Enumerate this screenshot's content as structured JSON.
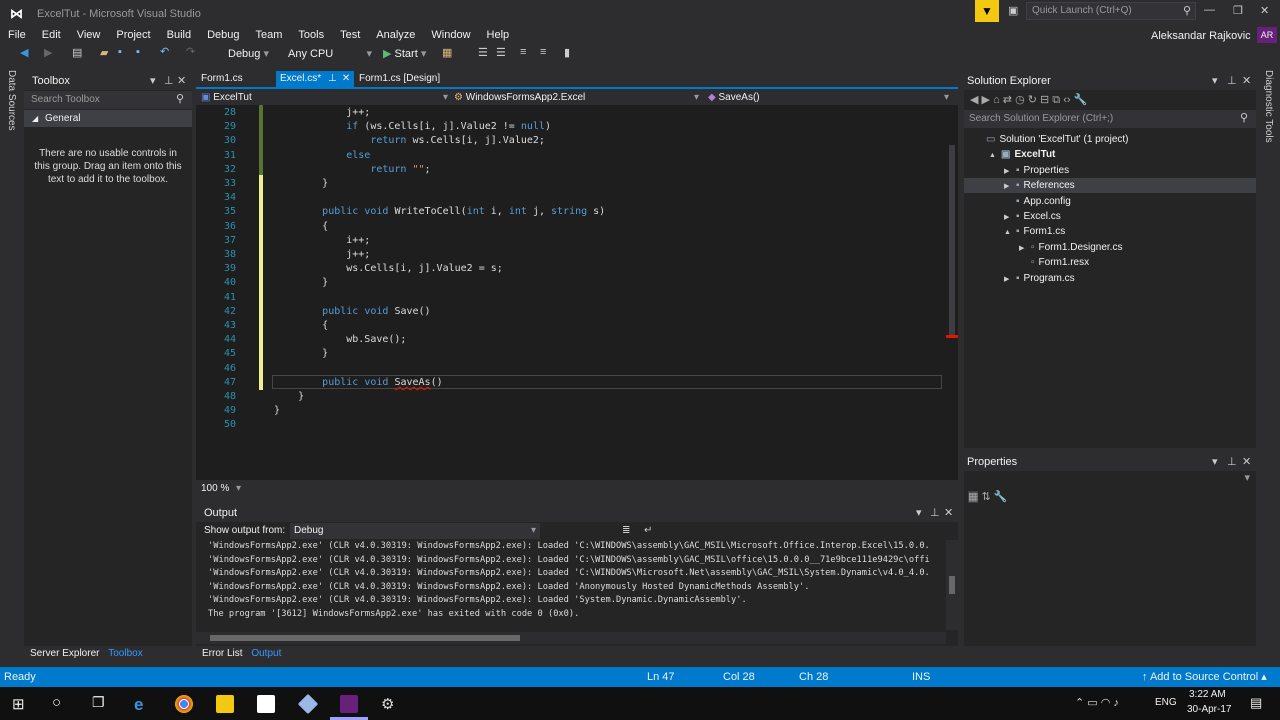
{
  "window": {
    "title": "ExcelTut - Microsoft Visual Studio",
    "quick_launch_placeholder": "Quick Launch (Ctrl+Q)",
    "user": "Aleksandar Rajkovic",
    "user_initials": "AR"
  },
  "menu": [
    "File",
    "Edit",
    "View",
    "Project",
    "Build",
    "Debug",
    "Team",
    "Tools",
    "Test",
    "Analyze",
    "Window",
    "Help"
  ],
  "toolbar": {
    "config": "Debug",
    "platform": "Any CPU",
    "start": "Start"
  },
  "left_strip": {
    "data_sources": "Data Sources"
  },
  "toolbox": {
    "title": "Toolbox",
    "search_placeholder": "Search Toolbox",
    "group": "General",
    "empty_text": "There are no usable controls in this group. Drag an item onto this text to add it to the toolbox."
  },
  "tabs": [
    {
      "label": "Form1.cs",
      "active": false
    },
    {
      "label": "Excel.cs*",
      "active": true
    },
    {
      "label": "Form1.cs [Design]",
      "active": false
    }
  ],
  "nav": {
    "project": "ExcelTut",
    "class": "WindowsFormsApp2.Excel",
    "member": "SaveAs()"
  },
  "code": [
    {
      "n": "28",
      "seg": [
        [
          "            ",
          "tx"
        ],
        [
          "j++;",
          "tx"
        ]
      ]
    },
    {
      "n": "29",
      "seg": [
        [
          "            ",
          "tx"
        ],
        [
          "if",
          "kw"
        ],
        [
          " (ws.Cells[i, j].Value2 != ",
          "tx"
        ],
        [
          "null",
          "kw"
        ],
        [
          ")",
          "tx"
        ]
      ]
    },
    {
      "n": "30",
      "seg": [
        [
          "                ",
          "tx"
        ],
        [
          "return",
          "kw"
        ],
        [
          " ws.Cells[i, j].Value2;",
          "tx"
        ]
      ]
    },
    {
      "n": "31",
      "seg": [
        [
          "            ",
          "tx"
        ],
        [
          "else",
          "kw"
        ]
      ]
    },
    {
      "n": "32",
      "seg": [
        [
          "                ",
          "tx"
        ],
        [
          "return",
          "kw"
        ],
        [
          " ",
          "tx"
        ],
        [
          "\"\"",
          "str"
        ],
        [
          ";",
          "tx"
        ]
      ]
    },
    {
      "n": "33",
      "seg": [
        [
          "        }",
          "tx"
        ]
      ]
    },
    {
      "n": "34",
      "seg": []
    },
    {
      "n": "35",
      "seg": [
        [
          "        ",
          "tx"
        ],
        [
          "public",
          "kw"
        ],
        [
          " ",
          "tx"
        ],
        [
          "void",
          "kw"
        ],
        [
          " WriteToCell(",
          "tx"
        ],
        [
          "int",
          "kw"
        ],
        [
          " i, ",
          "tx"
        ],
        [
          "int",
          "kw"
        ],
        [
          " j, ",
          "tx"
        ],
        [
          "string",
          "kw"
        ],
        [
          " s)",
          "tx"
        ]
      ]
    },
    {
      "n": "36",
      "seg": [
        [
          "        {",
          "tx"
        ]
      ]
    },
    {
      "n": "37",
      "seg": [
        [
          "            i++;",
          "tx"
        ]
      ]
    },
    {
      "n": "38",
      "seg": [
        [
          "            j++;",
          "tx"
        ]
      ]
    },
    {
      "n": "39",
      "seg": [
        [
          "            ws.Cells[i, j].Value2 = s;",
          "tx"
        ]
      ]
    },
    {
      "n": "40",
      "seg": [
        [
          "        }",
          "tx"
        ]
      ]
    },
    {
      "n": "41",
      "seg": []
    },
    {
      "n": "42",
      "seg": [
        [
          "        ",
          "tx"
        ],
        [
          "public",
          "kw"
        ],
        [
          " ",
          "tx"
        ],
        [
          "void",
          "kw"
        ],
        [
          " Save()",
          "tx"
        ]
      ]
    },
    {
      "n": "43",
      "seg": [
        [
          "        {",
          "tx"
        ]
      ]
    },
    {
      "n": "44",
      "seg": [
        [
          "            wb.Save();",
          "tx"
        ]
      ]
    },
    {
      "n": "45",
      "seg": [
        [
          "        }",
          "tx"
        ]
      ]
    },
    {
      "n": "46",
      "seg": []
    },
    {
      "n": "47",
      "seg": [
        [
          "        ",
          "tx"
        ],
        [
          "public",
          "kw"
        ],
        [
          " ",
          "tx"
        ],
        [
          "void",
          "kw"
        ],
        [
          " ",
          "tx"
        ],
        [
          "SaveAs",
          "err"
        ],
        [
          "()",
          "tx"
        ]
      ]
    },
    {
      "n": "48",
      "seg": [
        [
          "    }",
          "tx"
        ]
      ]
    },
    {
      "n": "49",
      "seg": [
        [
          "}",
          "tx"
        ]
      ]
    },
    {
      "n": "50",
      "seg": []
    }
  ],
  "editor": {
    "zoom": "100 %"
  },
  "output": {
    "title": "Output",
    "show_from_label": "Show output from:",
    "source": "Debug",
    "lines": [
      "'WindowsFormsApp2.exe' (CLR v4.0.30319: WindowsFormsApp2.exe): Loaded 'C:\\WINDOWS\\assembly\\GAC_MSIL\\Microsoft.Office.Interop.Excel\\15.0.0.",
      "'WindowsFormsApp2.exe' (CLR v4.0.30319: WindowsFormsApp2.exe): Loaded 'C:\\WINDOWS\\assembly\\GAC_MSIL\\office\\15.0.0.0__71e9bce111e9429c\\offi",
      "'WindowsFormsApp2.exe' (CLR v4.0.30319: WindowsFormsApp2.exe): Loaded 'C:\\WINDOWS\\Microsoft.Net\\assembly\\GAC_MSIL\\System.Dynamic\\v4.0_4.0.",
      "'WindowsFormsApp2.exe' (CLR v4.0.30319: WindowsFormsApp2.exe): Loaded 'Anonymously Hosted DynamicMethods Assembly'.",
      "'WindowsFormsApp2.exe' (CLR v4.0.30319: WindowsFormsApp2.exe): Loaded 'System.Dynamic.DynamicAssembly'.",
      "The program '[3612] WindowsFormsApp2.exe' has exited with code 0 (0x0)."
    ]
  },
  "bottom_tabs": {
    "left": [
      "Server Explorer",
      "Toolbox"
    ],
    "center": [
      "Error List",
      "Output"
    ]
  },
  "solution": {
    "title": "Solution Explorer",
    "search_placeholder": "Search Solution Explorer (Ctrl+;)",
    "items": [
      {
        "label": "Solution 'ExcelTut' (1 project)",
        "level": 0,
        "arrow": ""
      },
      {
        "label": "ExcelTut",
        "level": 1,
        "arrow": "▲",
        "bold": true
      },
      {
        "label": "Properties",
        "level": 2,
        "arrow": "▶"
      },
      {
        "label": "References",
        "level": 2,
        "arrow": "▶",
        "selected": true
      },
      {
        "label": "App.config",
        "level": 2,
        "arrow": ""
      },
      {
        "label": "Excel.cs",
        "level": 2,
        "arrow": "▶"
      },
      {
        "label": "Form1.cs",
        "level": 2,
        "arrow": "▲"
      },
      {
        "label": "Form1.Designer.cs",
        "level": 3,
        "arrow": "▶"
      },
      {
        "label": "Form1.resx",
        "level": 3,
        "arrow": ""
      },
      {
        "label": "Program.cs",
        "level": 2,
        "arrow": "▶"
      }
    ]
  },
  "properties": {
    "title": "Properties"
  },
  "right_strip": {
    "diagnostic": "Diagnostic Tools"
  },
  "status": {
    "ready": "Ready",
    "ln": "Ln 47",
    "col": "Col 28",
    "ch": "Ch 28",
    "ins": "INS",
    "source_control": "Add to Source Control"
  },
  "taskbar": {
    "lang": "ENG",
    "time": "3:22 AM",
    "date": "30-Apr-17"
  },
  "colors": {
    "accent": "#007acc",
    "keyword": "#569cd6",
    "line_number": "#2b91af",
    "editor_bg": "#1e1e1e"
  }
}
